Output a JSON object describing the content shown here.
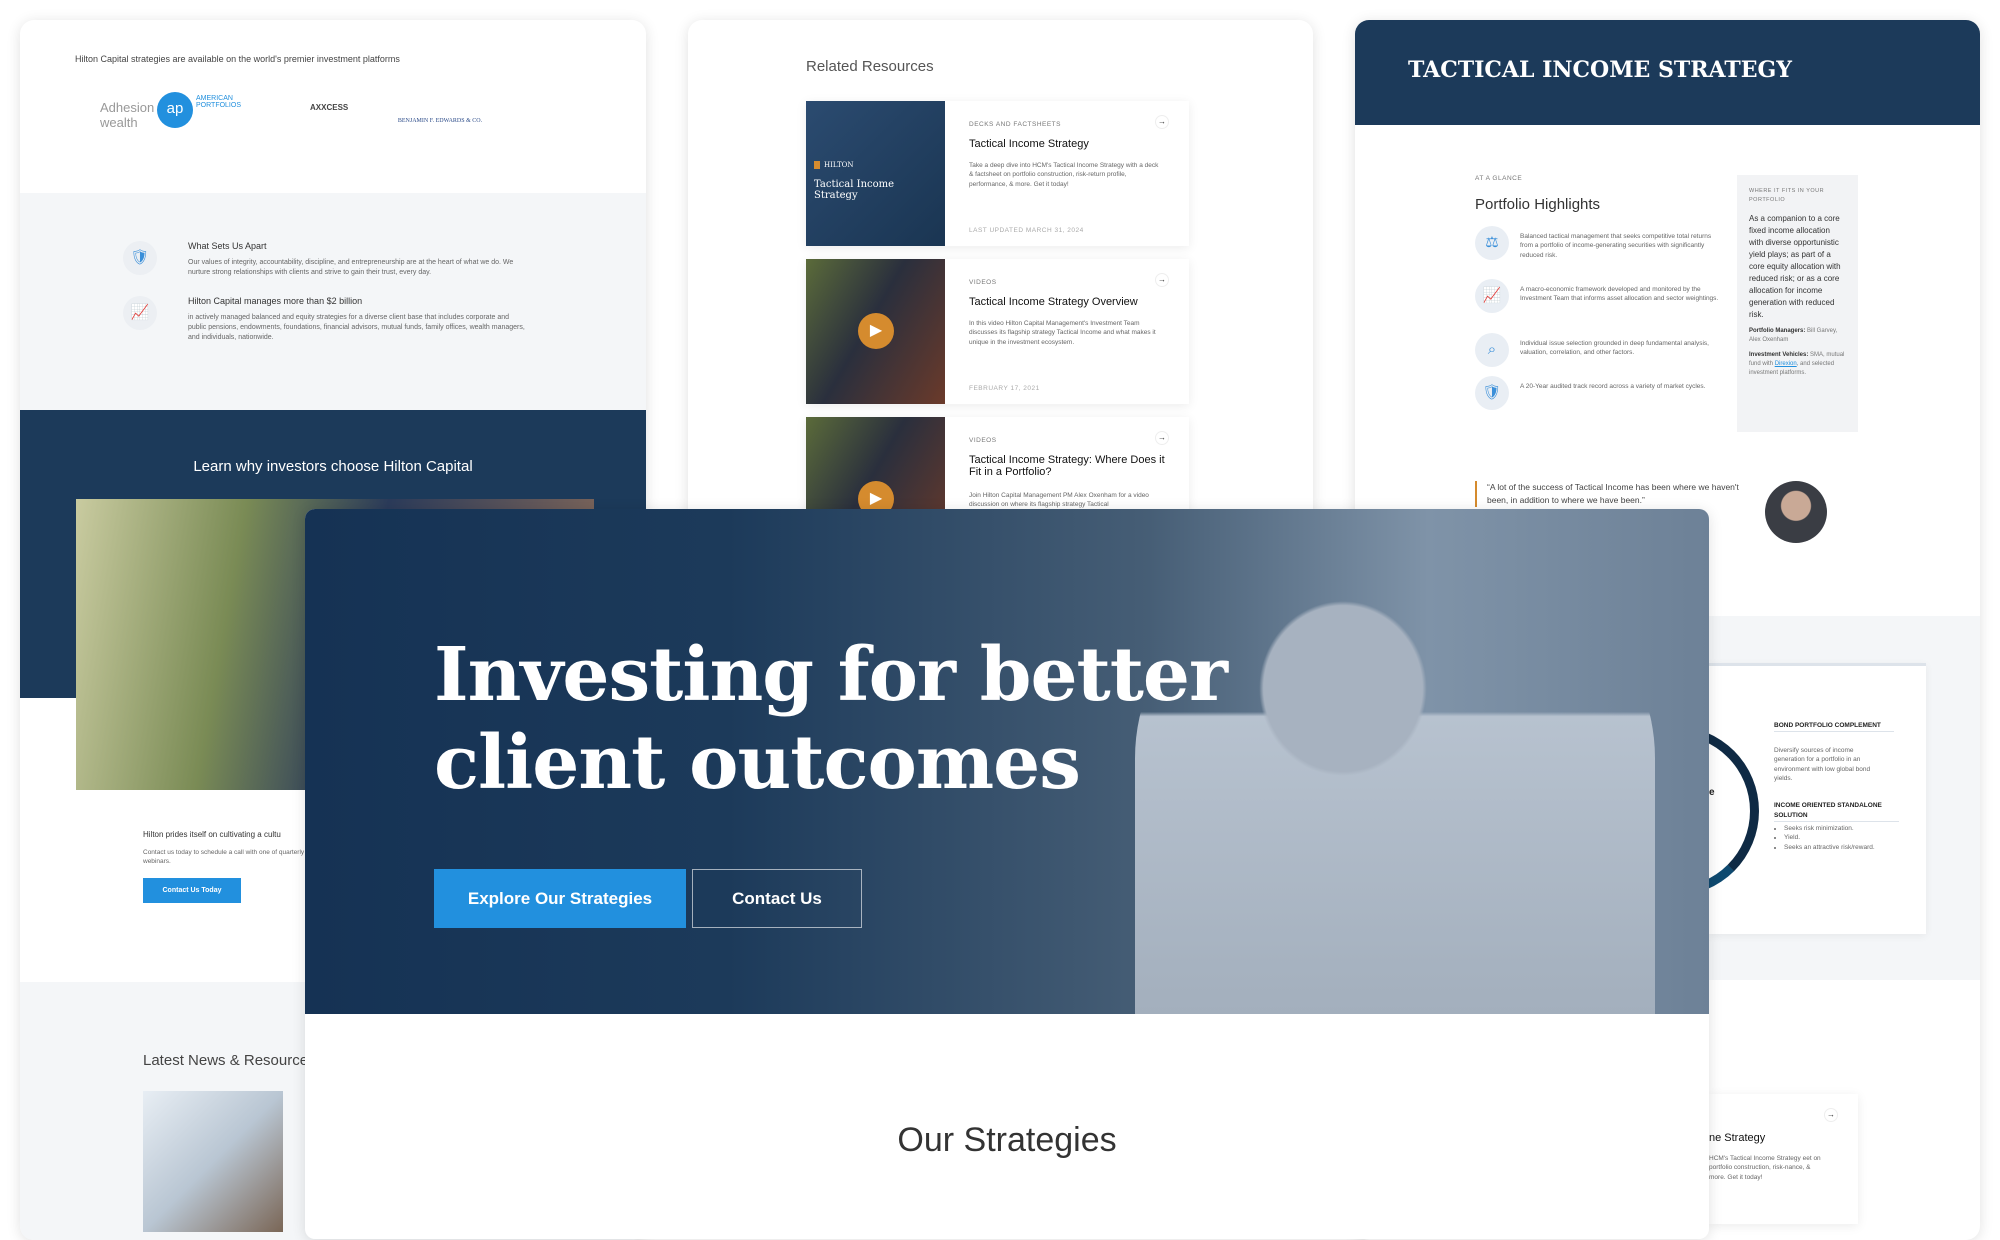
{
  "panel_a": {
    "platforms_heading": "Hilton Capital strategies are available on the world's premier investment platforms",
    "logos": [
      "Adhesion wealth",
      "AMERICAN PORTFOLIOS",
      "AXXCESS",
      "BENJAMIN F. EDWARDS & CO."
    ],
    "features": [
      {
        "icon": "shield-check-icon",
        "title": "What Sets Us Apart",
        "text": "Our values of integrity, accountability, discipline, and entrepreneurship are at the heart of what we do. We nurture strong relationships with clients and strive to gain their trust, every day."
      },
      {
        "icon": "presentation-chart-icon",
        "title": "Hilton Capital manages more than $2 billion",
        "text": "in actively managed balanced and equity strategies for a diverse client base that includes corporate and public pensions, endowments, foundations, financial advisors, mutual funds, family offices, wealth managers, and individuals, nationwide."
      }
    ],
    "band_title": "Learn why investors choose Hilton Capital",
    "culture_title": "Hilton prides itself on cultivating a cultu",
    "culture_text": "Contact us today to schedule a call with one of quarterly webinars.",
    "contact_button": "Contact Us Today",
    "news_title": "Latest News & Resource"
  },
  "panel_b": {
    "title": "Related Resources",
    "cards": [
      {
        "category": "DECKS AND FACTSHEETS",
        "title": "Tactical Income Strategy",
        "text": "Take a deep dive into HCM's Tactical Income Strategy with a deck & factsheet on portfolio construction, risk-return profile, performance, & more. Get it today!",
        "date": "LAST UPDATED MARCH 31, 2024",
        "thumb_brand": "HILTON",
        "thumb_title": "Tactical Income Strategy"
      },
      {
        "category": "VIDEOS",
        "title": "Tactical Income Strategy Overview",
        "text": "In this video Hilton Capital Management's Investment Team discusses its flagship strategy Tactical Income and what makes it unique in the investment ecosystem.",
        "date": "FEBRUARY 17, 2021"
      },
      {
        "category": "VIDEOS",
        "title": "Tactical Income Strategy: Where Does it Fit in a Portfolio?",
        "text": "Join Hilton Capital Management PM Alex Oxenham for a video discussion on where its flagship strategy Tactical"
      }
    ]
  },
  "panel_c": {
    "header": "TACTICAL INCOME STRATEGY",
    "eyebrow": "AT A GLANCE",
    "title": "Portfolio Highlights",
    "highlights": [
      {
        "icon": "scales-icon",
        "text": "Balanced tactical management that seeks competitive total returns from a portfolio of income-generating securities with significantly reduced risk."
      },
      {
        "icon": "presentation-chart-icon",
        "text": "A macro-economic framework developed and monitored by the Investment Team that informs asset allocation and sector weightings."
      },
      {
        "icon": "search-icon",
        "text": "Individual issue selection grounded in deep fundamental analysis, valuation, correlation, and other factors."
      },
      {
        "icon": "shield-check-icon",
        "text": "A 20-Year audited track record across a variety of market cycles."
      }
    ],
    "side_eyebrow": "WHERE IT FITS IN YOUR PORTFOLIO",
    "side_text": "As a companion to a core fixed income allocation with diverse opportunistic yield plays; as part of a core equity allocation with reduced risk; or as a core allocation for income generation with reduced risk.",
    "managers_label": "Portfolio Managers:",
    "managers": "Bill Garvey, Alex Oxenham",
    "vehicles_label": "Investment Vehicles:",
    "vehicles_pre": "SMA, mutual fund with",
    "vehicles_link": "Direxion",
    "vehicles_post": ", and selected investment platforms.",
    "quote": "“A lot of the success of Tactical Income has been where we haven't been, in addition to where we have been.”",
    "diagram_fragment": "e",
    "bond_title": "BOND PORTFOLIO COMPLEMENT",
    "bond_text": "Diversify sources of income generation for a portfolio in an environment with low global bond yields.",
    "standalone_title": "INCOME ORIENTED STANDALONE SOLUTION",
    "standalone_items": [
      "Seeks risk minimization.",
      "Yield.",
      "Seeks an attractive risk/reward."
    ],
    "card_title": "ne Strategy",
    "card_text": "HCM's Tactical Income Strategy eet on portfolio construction, risk-nance, & more. Get it today!"
  },
  "hero": {
    "headline": "Investing for better client outcomes",
    "primary_button": "Explore Our Strategies",
    "secondary_button": "Contact Us",
    "strategies_title": "Our Strategies"
  },
  "colors": {
    "navy": "#1c3a5a",
    "accent_blue": "#2290de",
    "orange": "#d58b2e",
    "gray_bg": "#f4f6f8"
  }
}
